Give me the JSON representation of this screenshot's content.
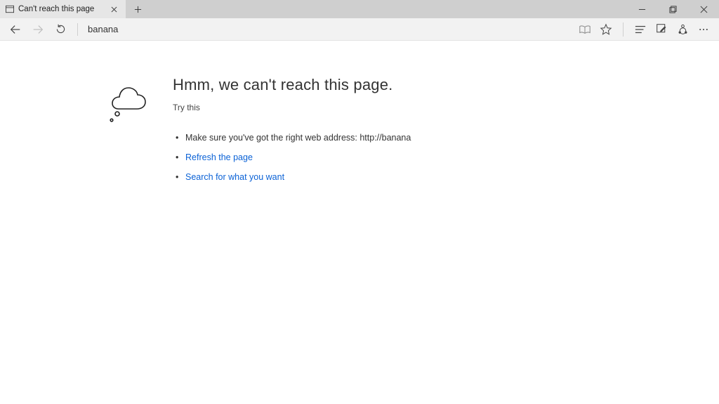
{
  "tab": {
    "title": "Can't reach this page"
  },
  "addressbar": {
    "value": "banana"
  },
  "error": {
    "heading": "Hmm, we can't reach this page.",
    "try_heading": "Try this",
    "tip_address": "Make sure you've got the right web address: http://banana",
    "tip_refresh": "Refresh the page",
    "tip_search": "Search for what you want"
  }
}
